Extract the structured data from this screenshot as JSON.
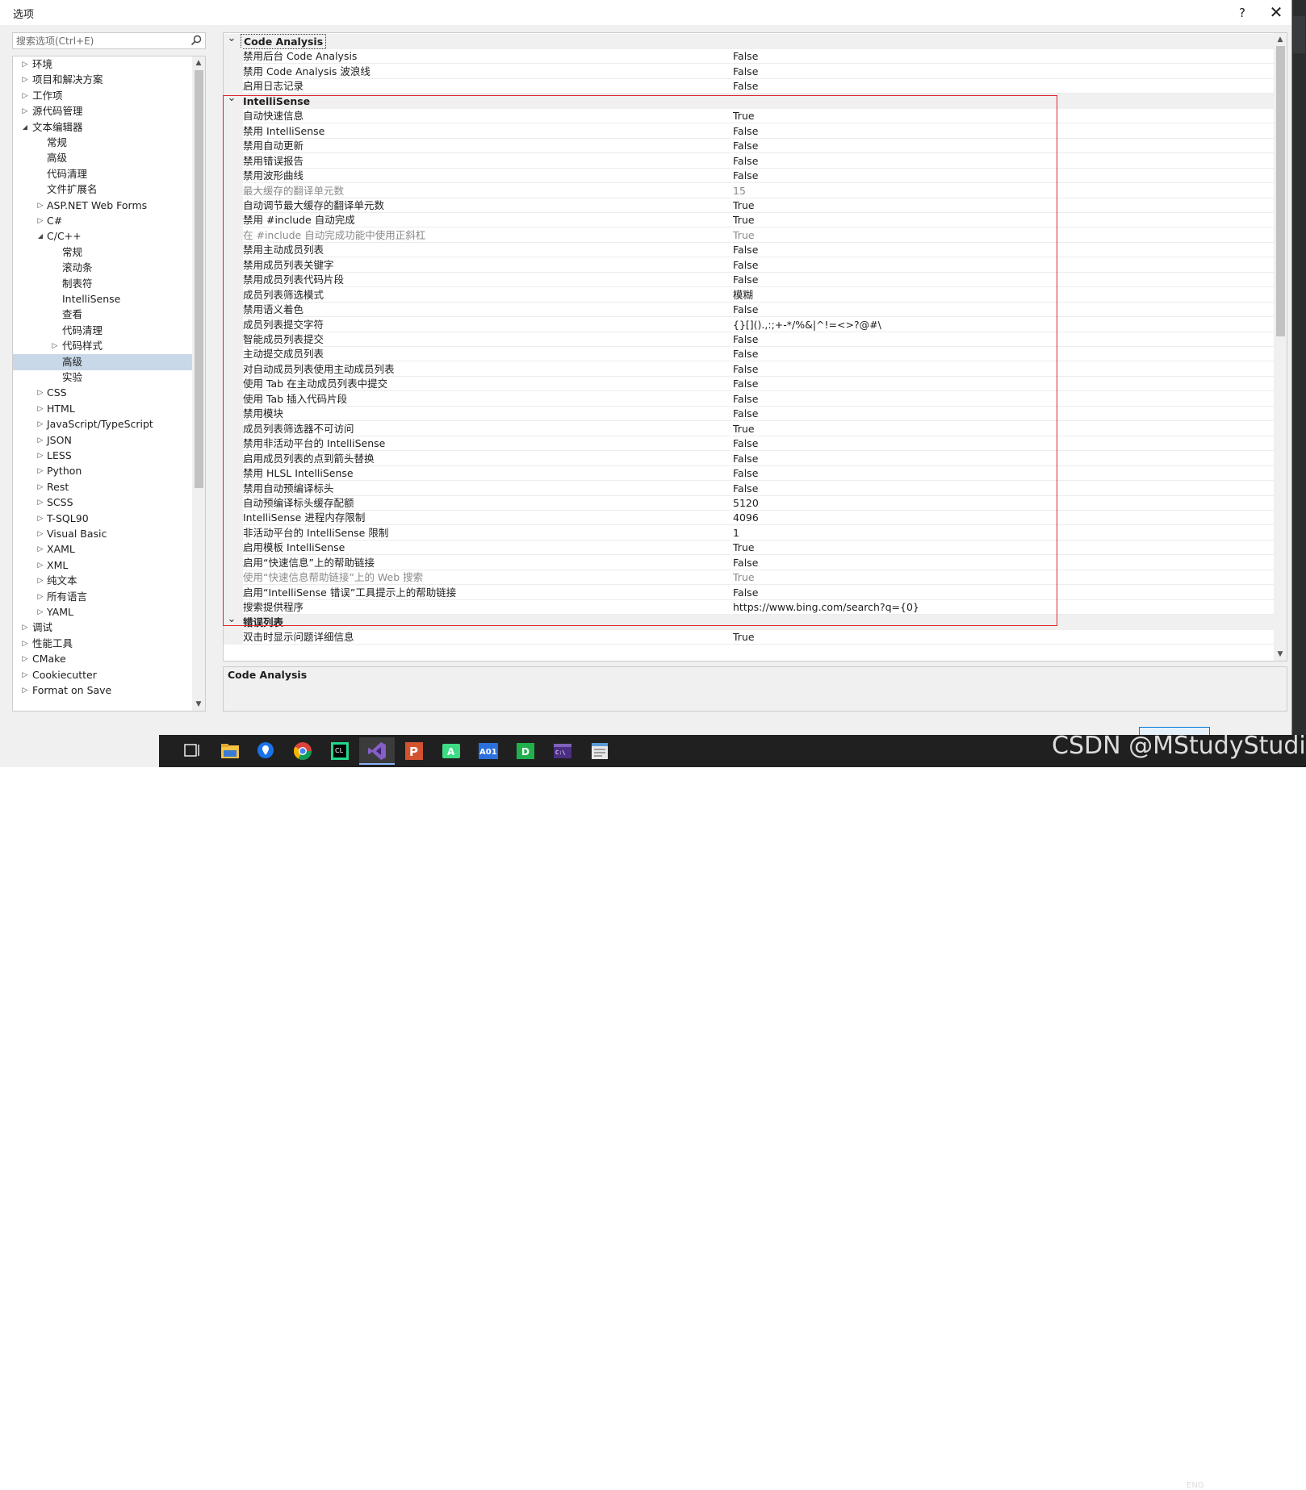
{
  "window": {
    "title": "选项",
    "help": "?",
    "close": "✕"
  },
  "search": {
    "placeholder": "搜索选项(Ctrl+E)"
  },
  "tree": {
    "items": [
      {
        "label": "环境",
        "level": 0,
        "arrow": "collapsed"
      },
      {
        "label": "项目和解决方案",
        "level": 0,
        "arrow": "collapsed"
      },
      {
        "label": "工作项",
        "level": 0,
        "arrow": "collapsed"
      },
      {
        "label": "源代码管理",
        "level": 0,
        "arrow": "collapsed"
      },
      {
        "label": "文本编辑器",
        "level": 0,
        "arrow": "expanded"
      },
      {
        "label": "常规",
        "level": 1,
        "arrow": "none"
      },
      {
        "label": "高级",
        "level": 1,
        "arrow": "none"
      },
      {
        "label": "代码清理",
        "level": 1,
        "arrow": "none"
      },
      {
        "label": "文件扩展名",
        "level": 1,
        "arrow": "none"
      },
      {
        "label": "ASP.NET Web Forms",
        "level": 1,
        "arrow": "collapsed"
      },
      {
        "label": "C#",
        "level": 1,
        "arrow": "collapsed"
      },
      {
        "label": "C/C++",
        "level": 1,
        "arrow": "expanded"
      },
      {
        "label": "常规",
        "level": 2,
        "arrow": "none"
      },
      {
        "label": "滚动条",
        "level": 2,
        "arrow": "none"
      },
      {
        "label": "制表符",
        "level": 2,
        "arrow": "none"
      },
      {
        "label": "IntelliSense",
        "level": 2,
        "arrow": "none"
      },
      {
        "label": "查看",
        "level": 2,
        "arrow": "none"
      },
      {
        "label": "代码清理",
        "level": 2,
        "arrow": "none"
      },
      {
        "label": "代码样式",
        "level": 2,
        "arrow": "collapsed"
      },
      {
        "label": "高级",
        "level": 2,
        "arrow": "none",
        "selected": true
      },
      {
        "label": "实验",
        "level": 2,
        "arrow": "none"
      },
      {
        "label": "CSS",
        "level": 1,
        "arrow": "collapsed"
      },
      {
        "label": "HTML",
        "level": 1,
        "arrow": "collapsed"
      },
      {
        "label": "JavaScript/TypeScript",
        "level": 1,
        "arrow": "collapsed"
      },
      {
        "label": "JSON",
        "level": 1,
        "arrow": "collapsed"
      },
      {
        "label": "LESS",
        "level": 1,
        "arrow": "collapsed"
      },
      {
        "label": "Python",
        "level": 1,
        "arrow": "collapsed"
      },
      {
        "label": "Rest",
        "level": 1,
        "arrow": "collapsed"
      },
      {
        "label": "SCSS",
        "level": 1,
        "arrow": "collapsed"
      },
      {
        "label": "T-SQL90",
        "level": 1,
        "arrow": "collapsed"
      },
      {
        "label": "Visual Basic",
        "level": 1,
        "arrow": "collapsed"
      },
      {
        "label": "XAML",
        "level": 1,
        "arrow": "collapsed"
      },
      {
        "label": "XML",
        "level": 1,
        "arrow": "collapsed"
      },
      {
        "label": "纯文本",
        "level": 1,
        "arrow": "collapsed"
      },
      {
        "label": "所有语言",
        "level": 1,
        "arrow": "collapsed"
      },
      {
        "label": "YAML",
        "level": 1,
        "arrow": "collapsed"
      },
      {
        "label": "调试",
        "level": 0,
        "arrow": "collapsed"
      },
      {
        "label": "性能工具",
        "level": 0,
        "arrow": "collapsed"
      },
      {
        "label": "CMake",
        "level": 0,
        "arrow": "collapsed"
      },
      {
        "label": "Cookiecutter",
        "level": 0,
        "arrow": "collapsed"
      },
      {
        "label": "Format on Save",
        "level": 0,
        "arrow": "collapsed"
      }
    ]
  },
  "grid": {
    "rows": [
      {
        "type": "category",
        "name": "Code Analysis",
        "focus": true
      },
      {
        "type": "prop",
        "name": "禁用后台 Code Analysis",
        "value": "False"
      },
      {
        "type": "prop",
        "name": "禁用 Code Analysis 波浪线",
        "value": "False"
      },
      {
        "type": "prop",
        "name": "启用日志记录",
        "value": "False"
      },
      {
        "type": "category",
        "name": "IntelliSense"
      },
      {
        "type": "prop",
        "name": "自动快速信息",
        "value": "True"
      },
      {
        "type": "prop",
        "name": "禁用 IntelliSense",
        "value": "False"
      },
      {
        "type": "prop",
        "name": "禁用自动更新",
        "value": "False"
      },
      {
        "type": "prop",
        "name": "禁用错误报告",
        "value": "False"
      },
      {
        "type": "prop",
        "name": "禁用波形曲线",
        "value": "False"
      },
      {
        "type": "prop",
        "name": "最大缓存的翻译单元数",
        "value": "15",
        "disabled": true
      },
      {
        "type": "prop",
        "name": "自动调节最大缓存的翻译单元数",
        "value": "True"
      },
      {
        "type": "prop",
        "name": "禁用 #include 自动完成",
        "value": "True"
      },
      {
        "type": "prop",
        "name": "在 #include 自动完成功能中使用正斜杠",
        "value": "True",
        "disabled": true
      },
      {
        "type": "prop",
        "name": "禁用主动成员列表",
        "value": "False"
      },
      {
        "type": "prop",
        "name": "禁用成员列表关键字",
        "value": "False"
      },
      {
        "type": "prop",
        "name": "禁用成员列表代码片段",
        "value": "False"
      },
      {
        "type": "prop",
        "name": "成员列表筛选模式",
        "value": "模糊"
      },
      {
        "type": "prop",
        "name": "禁用语义着色",
        "value": "False"
      },
      {
        "type": "prop",
        "name": "成员列表提交字符",
        "value": "{}[]().,:;+-*/%&|^!=<>?@#\\"
      },
      {
        "type": "prop",
        "name": "智能成员列表提交",
        "value": "False"
      },
      {
        "type": "prop",
        "name": "主动提交成员列表",
        "value": "False"
      },
      {
        "type": "prop",
        "name": "对自动成员列表使用主动成员列表",
        "value": "False"
      },
      {
        "type": "prop",
        "name": "使用 Tab 在主动成员列表中提交",
        "value": "False"
      },
      {
        "type": "prop",
        "name": "使用 Tab 插入代码片段",
        "value": "False"
      },
      {
        "type": "prop",
        "name": "禁用模块",
        "value": "False"
      },
      {
        "type": "prop",
        "name": "成员列表筛选器不可访问",
        "value": "True"
      },
      {
        "type": "prop",
        "name": "禁用非活动平台的 IntelliSense",
        "value": "False"
      },
      {
        "type": "prop",
        "name": "启用成员列表的点到箭头替换",
        "value": "False"
      },
      {
        "type": "prop",
        "name": "禁用 HLSL IntelliSense",
        "value": "False"
      },
      {
        "type": "prop",
        "name": "禁用自动预编译标头",
        "value": "False"
      },
      {
        "type": "prop",
        "name": "自动预编译标头缓存配额",
        "value": "5120"
      },
      {
        "type": "prop",
        "name": "IntelliSense 进程内存限制",
        "value": "4096"
      },
      {
        "type": "prop",
        "name": "非活动平台的 IntelliSense 限制",
        "value": "1"
      },
      {
        "type": "prop",
        "name": "启用模板 IntelliSense",
        "value": "True"
      },
      {
        "type": "prop",
        "name": "启用“快速信息”上的帮助链接",
        "value": "False"
      },
      {
        "type": "prop",
        "name": "使用“快速信息帮助链接”上的 Web 搜索",
        "value": "True",
        "disabled": true
      },
      {
        "type": "prop",
        "name": "启用“IntelliSense 错误”工具提示上的帮助链接",
        "value": "False"
      },
      {
        "type": "prop",
        "name": "搜索提供程序",
        "value": "https://www.bing.com/search?q={0}"
      },
      {
        "type": "category",
        "name": "错误列表"
      },
      {
        "type": "prop",
        "name": "双击时显示问题详细信息",
        "value": "True"
      }
    ]
  },
  "description": {
    "title": "Code Analysis"
  },
  "taskbar": {
    "icons": [
      "task-view-icon",
      "file-explorer-icon",
      "maps-icon",
      "chrome-icon",
      "clion-icon",
      "visual-studio-icon",
      "powerpoint-icon",
      "android-studio-icon",
      "aoi-app-icon",
      "datagrip-icon",
      "terminal-icon",
      "notepad-icon"
    ]
  },
  "watermark": "CSDN @MStudyStudio",
  "tray": {
    "lang": "ENG"
  }
}
